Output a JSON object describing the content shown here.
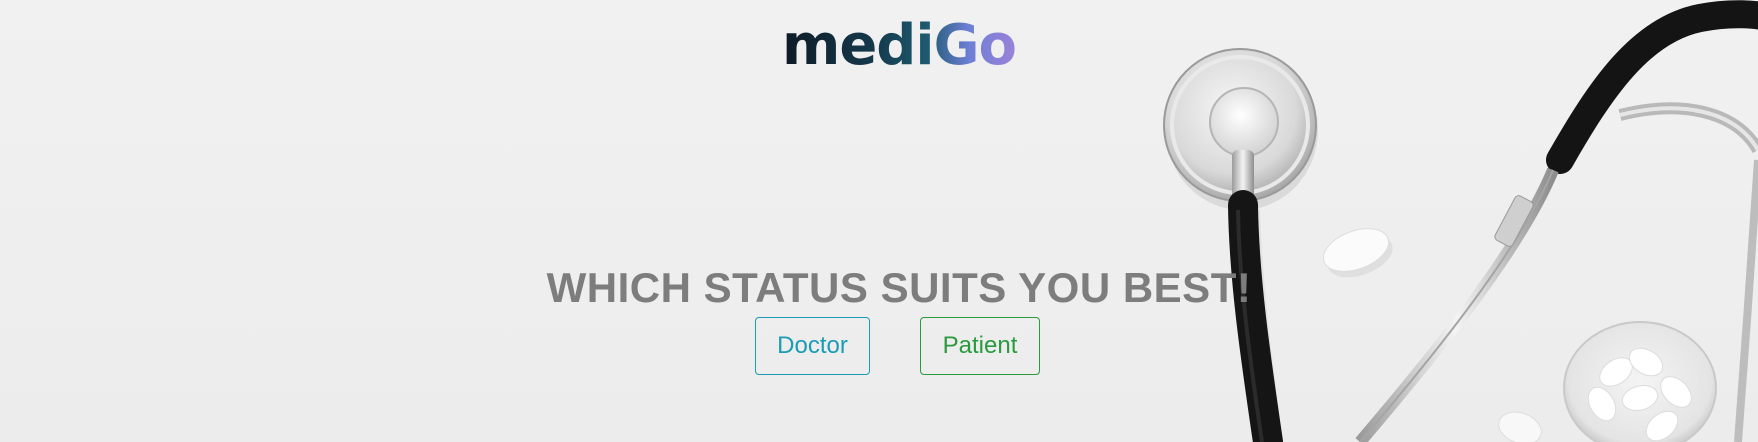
{
  "brand": {
    "logo_text": "mediGo"
  },
  "main": {
    "headline": "WHICH STATUS SUITS YOU BEST!",
    "buttons": {
      "doctor_label": "Doctor",
      "patient_label": "Patient"
    }
  },
  "colors": {
    "headline": "#7d7d7d",
    "doctor_accent": "#1a9cb4",
    "patient_accent": "#2a9a3e",
    "background": "#efefef"
  },
  "icons": [
    "stethoscope-illustration",
    "pill-illustration"
  ]
}
